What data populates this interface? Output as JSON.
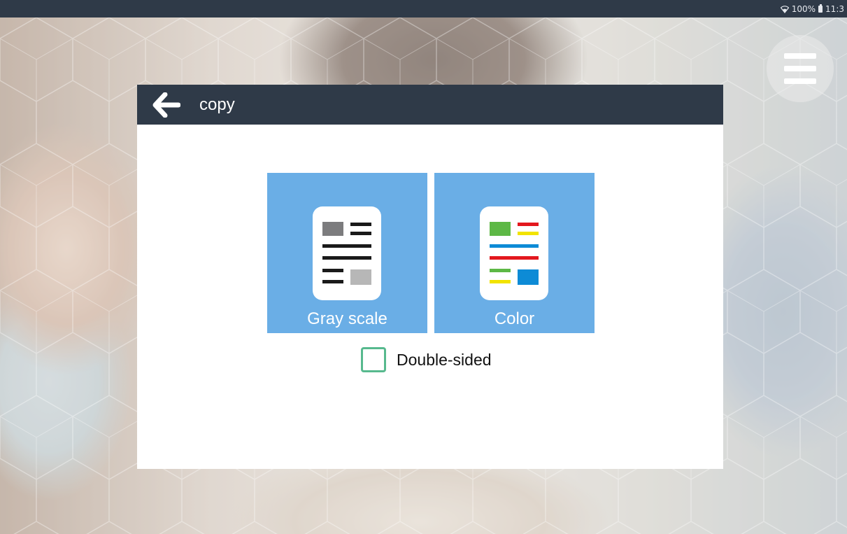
{
  "status_bar": {
    "battery": "100%",
    "time": "11:3"
  },
  "menu": {
    "icon": "hamburger-menu-icon"
  },
  "dialog": {
    "title": "copy",
    "back_icon": "arrow-left-icon",
    "options": [
      {
        "label": "Gray scale",
        "icon": "grayscale-document-icon"
      },
      {
        "label": "Color",
        "icon": "color-document-icon"
      }
    ],
    "double_sided": {
      "label": "Double-sided",
      "checked": false
    }
  },
  "colors": {
    "header_bg": "#2f3a48",
    "tile_bg": "#6aaee6",
    "checkbox_border": "#57b98e",
    "doc_green": "#5db845",
    "doc_red": "#e3181e",
    "doc_yellow": "#f2e300",
    "doc_blue": "#0d8bd6"
  }
}
